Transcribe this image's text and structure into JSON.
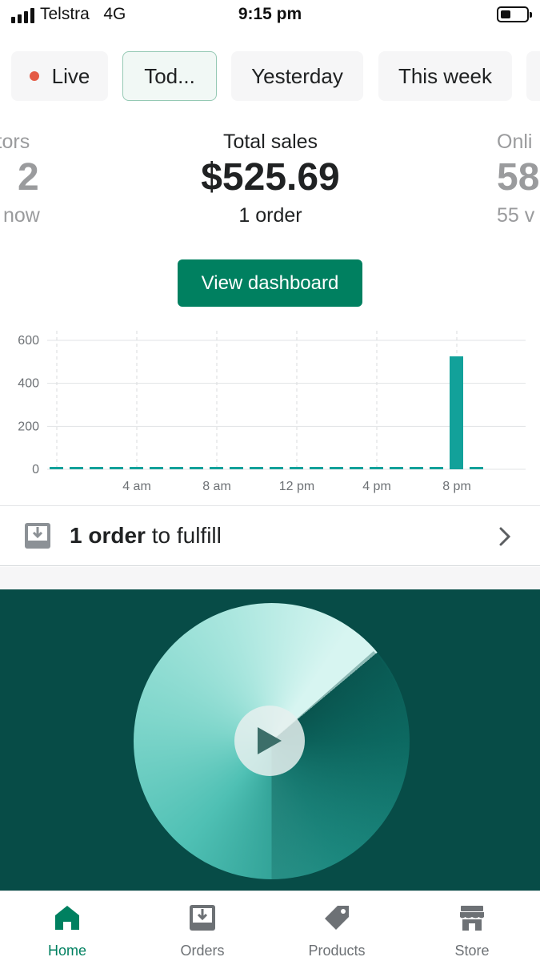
{
  "status_bar": {
    "carrier": "Telstra",
    "network": "4G",
    "time": "9:15 pm"
  },
  "date_chips": [
    {
      "label": "Live"
    },
    {
      "label": "Tod..."
    },
    {
      "label": "Yesterday"
    },
    {
      "label": "This week"
    }
  ],
  "metrics": {
    "left": {
      "label": "itors",
      "value": "2",
      "sub": "now"
    },
    "center": {
      "label": "Total sales",
      "value": "$525.69",
      "sub": "1 order"
    },
    "right": {
      "label": "Onli",
      "value": "58",
      "sub": "55 v"
    }
  },
  "view_dashboard_label": "View dashboard",
  "chart_data": {
    "type": "bar",
    "categories": [
      "12 am",
      "1 am",
      "2 am",
      "3 am",
      "4 am",
      "5 am",
      "6 am",
      "7 am",
      "8 am",
      "9 am",
      "10 am",
      "11 am",
      "12 pm",
      "1 pm",
      "2 pm",
      "3 pm",
      "4 pm",
      "5 pm",
      "6 pm",
      "7 pm",
      "8 pm",
      "9 pm"
    ],
    "values": [
      0,
      0,
      0,
      0,
      0,
      0,
      0,
      0,
      0,
      0,
      0,
      0,
      0,
      0,
      0,
      0,
      0,
      0,
      0,
      0,
      525.69,
      0
    ],
    "x_tick_labels": [
      "4 am",
      "8 am",
      "12 pm",
      "4 pm",
      "8 pm"
    ],
    "y_ticks": [
      0,
      200,
      400,
      600
    ],
    "ylim": [
      0,
      600
    ],
    "grid": true,
    "color": "#12a19a"
  },
  "fulfill": {
    "count_text": "1 order",
    "rest_text": " to fulfill"
  },
  "tabs": [
    {
      "label": "Home",
      "icon": "home-icon",
      "active": true
    },
    {
      "label": "Orders",
      "icon": "orders-icon",
      "active": false
    },
    {
      "label": "Products",
      "icon": "tag-icon",
      "active": false
    },
    {
      "label": "Store",
      "icon": "store-icon",
      "active": false
    }
  ],
  "colors": {
    "accent": "#008060",
    "live_dot": "#e45a45",
    "video_bg": "#074c47",
    "bar": "#12a19a"
  }
}
